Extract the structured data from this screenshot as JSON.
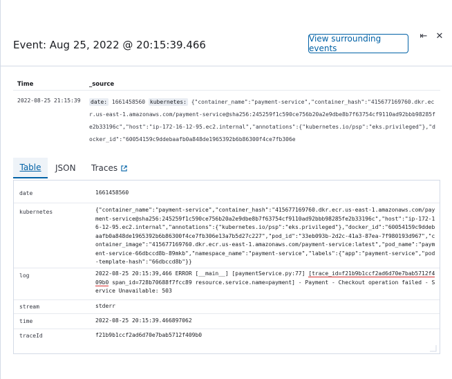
{
  "header": {
    "title": "Event: Aug 25, 2022 @ 20:15:39.466",
    "surround_button": "View surrounding events",
    "collapse_icon": "⇤",
    "close_icon": "✕"
  },
  "summary": {
    "col_time": "Time",
    "col_source": "_source",
    "time_value": "2022-08-25 21:15:39",
    "date_key": "date:",
    "date_value": "1661458560",
    "kubernetes_key": "kubernetes:",
    "kubernetes_value": "{\"container_name\":\"payment-service\",\"container_hash\":\"415677169760.dkr.ecr.us-east-1.amazonaws.com/payment-service@sha256:245259f1c590ce756b20a2e9dbe8b7f63754cf9110ad92bbb98285fe2b33196c\",\"host\":\"ip-172-16-12-95.ec2.internal\",\"annotations\":{\"kubernetes.io/psp\":\"eks.privileged\"},\"docker_id\":\"60054159c9ddebaafb0a848de1965392b6b86300f4ce7fb306e"
  },
  "tabs": [
    {
      "label": "Table"
    },
    {
      "label": "JSON"
    },
    {
      "label": "Traces"
    }
  ],
  "fields": [
    {
      "key": "date",
      "value": "1661458560"
    },
    {
      "key": "kubernetes",
      "value": "{\"container_name\":\"payment-service\",\"container_hash\":\"415677169760.dkr.ecr.us-east-1.amazonaws.com/payment-service@sha256:245259f1c590ce756b20a2e9dbe8b7f63754cf9110ad92bbb98285fe2b33196c\",\"host\":\"ip-172-16-12-95.ec2.internal\",\"annotations\":{\"kubernetes.io/psp\":\"eks.privileged\"},\"docker_id\":\"60054159c9ddebaafb0a848de1965392b6b86300f4ce7fb306e13a7b5d27c227\",\"pod_id\":\"33eb093b-2d2c-41a3-87ea-7f980193d967\",\"container_image\":\"415677169760.dkr.ecr.us-east-1.amazonaws.com/payment-service:latest\",\"pod_name\":\"payment-service-66dbccd8b-89mkb\",\"namespace_name\":\"payment-service\",\"labels\":{\"app\":\"payment-service\",\"pod-template-hash\":\"66dbccd8b\"}}"
    },
    {
      "key": "log",
      "value_prefix": "2022-08-25 20:15:39,466 ERROR [__main__] [paymentService.py:77] ",
      "value_highlight": "[trace_id=f21b9b1ccf2ad6d70e7bab5712f409b0",
      "value_suffix": " span_id=728b70688f7fcc89 resource.service.name=payment] - Payment - Checkout operation failed - Service Unavailable: 503"
    },
    {
      "key": "stream",
      "value": "stderr"
    },
    {
      "key": "time",
      "value": "2022-08-25 20:15:39.466897062"
    },
    {
      "key": "traceId",
      "value": "f21b9b1ccf2ad6d70e7bab5712f409b0"
    }
  ],
  "colors": {
    "accent": "#0061a6",
    "highlight": "#d62b2b"
  }
}
